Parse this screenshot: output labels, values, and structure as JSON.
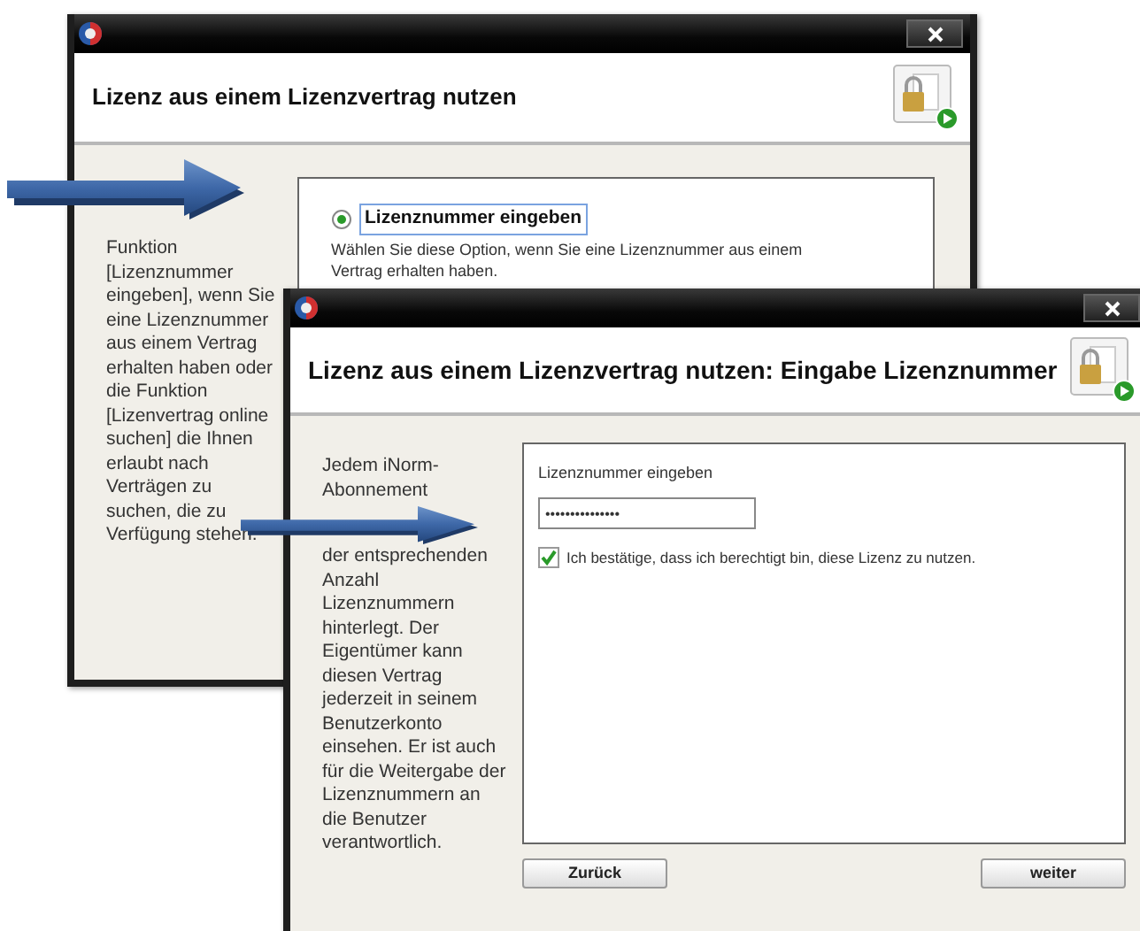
{
  "back_window": {
    "title": "Lizenz aus einem Lizenzvertrag nutzen",
    "sidebar_text": "Funktion [Lizenznummer eingeben], wenn Sie eine Lizenznummer aus einem Vertrag erhalten haben oder die Funktion [Lizenvertrag online suchen] die Ihnen erlaubt nach Verträgen zu suchen, die zu Verfügung stehen.",
    "option": {
      "label": "Lizenznummer eingeben",
      "selected": true,
      "description": "Wählen Sie diese Option, wenn Sie eine Lizenznummer aus einem Vertrag erhalten haben."
    }
  },
  "front_window": {
    "title": "Lizenz aus einem Lizenzvertrag nutzen: Eingabe Lizenznummer",
    "sidebar_text_top": "Jedem iNorm-Abonnement",
    "sidebar_text_bottom": "der entsprechenden Anzahl Lizenznummern hinterlegt. Der Eigentümer kann diesen Vertrag jederzeit in seinem Benutzerkonto einsehen. Er ist auch für die Weitergabe der Lizenznummern an die Benutzer verantwortlich.",
    "field": {
      "label": "Lizenznummer eingeben",
      "value": "•••••••••••••••"
    },
    "confirm": {
      "label": "Ich bestätige, dass ich berechtigt bin, diese Lizenz zu nutzen.",
      "checked": true
    },
    "buttons": [
      {
        "label": "Zurück"
      },
      {
        "label": "weiter"
      }
    ]
  }
}
